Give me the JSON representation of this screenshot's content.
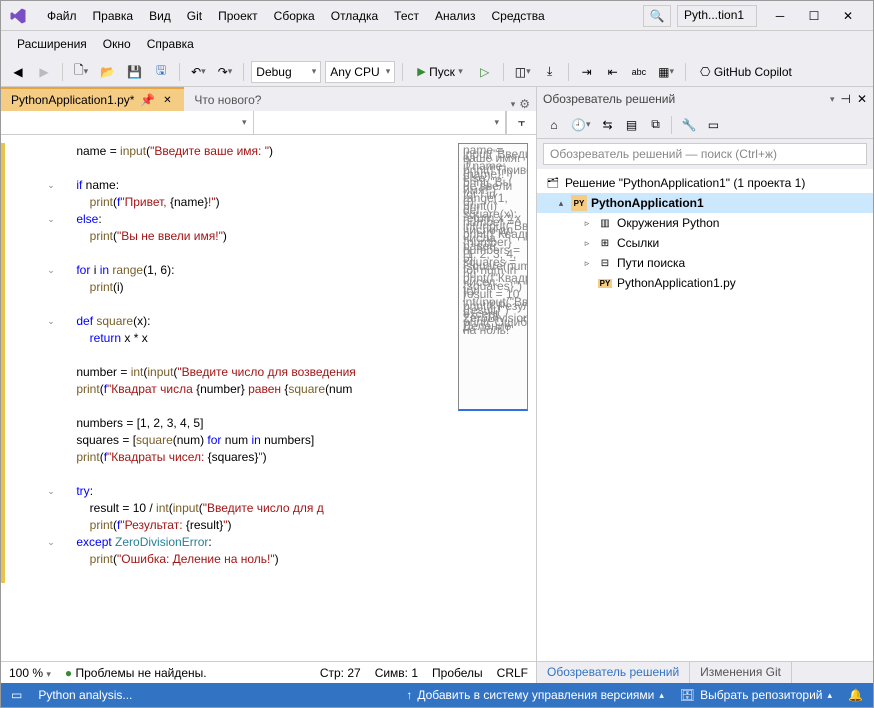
{
  "title_short": "Pyth...tion1",
  "menus": [
    "Файл",
    "Правка",
    "Вид",
    "Git",
    "Проект",
    "Сборка",
    "Отладка",
    "Тест",
    "Анализ",
    "Средства"
  ],
  "menus2": [
    "Расширения",
    "Окно",
    "Справка"
  ],
  "toolbar": {
    "config": "Debug",
    "platform": "Any CPU",
    "run": "Пуск",
    "copilot": "GitHub Copilot"
  },
  "tabs": {
    "active": "PythonApplication1.py*",
    "inactive": "Что нового?"
  },
  "code_lines": [
    {
      "indent": 1,
      "html": "name = <span class='fn'>input</span>(<span class='str'>\"Введите ваше имя: \"</span>)"
    },
    {
      "indent": 1,
      "html": ""
    },
    {
      "fold": true,
      "indent": 1,
      "html": "<span class='kw'>if</span> name:"
    },
    {
      "indent": 2,
      "html": "<span class='fn'>print</span>(<span class='kw'>f</span><span class='str'>\"Привет, </span>{name}<span class='str'>!\"</span>)"
    },
    {
      "fold": true,
      "indent": 1,
      "html": "<span class='kw'>else</span>:"
    },
    {
      "indent": 2,
      "html": "<span class='fn'>print</span>(<span class='str'>\"Вы не ввели имя!\"</span>)"
    },
    {
      "indent": 1,
      "html": ""
    },
    {
      "fold": true,
      "indent": 1,
      "html": "<span class='kw'>for</span> i <span class='kw'>in</span> <span class='fn'>range</span>(1, 6):"
    },
    {
      "indent": 2,
      "html": "<span class='fn'>print</span>(i)"
    },
    {
      "indent": 1,
      "html": ""
    },
    {
      "fold": true,
      "indent": 1,
      "html": "<span class='kw'>def</span> <span class='fn'>square</span>(x):"
    },
    {
      "indent": 2,
      "html": "<span class='kw'>return</span> x * x"
    },
    {
      "indent": 1,
      "html": ""
    },
    {
      "indent": 1,
      "html": "number = <span class='fn'>int</span>(<span class='fn'>input</span>(<span class='str'>\"Введите число для возведения</span>"
    },
    {
      "indent": 1,
      "html": "<span class='fn'>print</span>(<span class='kw'>f</span><span class='str'>\"Квадрат числа </span>{number}<span class='str'> равен </span>{<span class='fn'>square</span>(num"
    },
    {
      "indent": 1,
      "html": ""
    },
    {
      "indent": 1,
      "html": "numbers = [1, 2, 3, 4, 5]"
    },
    {
      "indent": 1,
      "html": "squares = [<span class='fn'>square</span>(num) <span class='kw'>for</span> num <span class='kw'>in</span> numbers]"
    },
    {
      "indent": 1,
      "html": "<span class='fn'>print</span>(<span class='kw'>f</span><span class='str'>\"Квадраты чисел: </span>{squares}<span class='str'>\"</span>)"
    },
    {
      "indent": 1,
      "html": ""
    },
    {
      "fold": true,
      "indent": 1,
      "html": "<span class='kw'>try</span>:"
    },
    {
      "indent": 2,
      "html": "result = 10 / <span class='fn'>int</span>(<span class='fn'>input</span>(<span class='str'>\"Введите число для д</span>"
    },
    {
      "indent": 2,
      "html": "<span class='fn'>print</span>(<span class='kw'>f</span><span class='str'>\"Результат: </span>{result}<span class='str'>\"</span>)"
    },
    {
      "fold": true,
      "indent": 1,
      "html": "<span class='kw'>except</span> <span class='cls'>ZeroDivisionError</span>:"
    },
    {
      "indent": 2,
      "html": "<span class='fn'>print</span>(<span class='str'>\"Ошибка: Деление на ноль!\"</span>)"
    },
    {
      "indent": 2,
      "html": ""
    }
  ],
  "editor_status": {
    "zoom": "100 %",
    "problems": "Проблемы не найдены.",
    "line": "Стр: 27",
    "col": "Симв: 1",
    "spaces": "Пробелы",
    "eol": "CRLF"
  },
  "solution": {
    "title": "Обозреватель решений",
    "search_placeholder": "Обозреватель решений — поиск (Ctrl+ж)",
    "root": "Решение \"PythonApplication1\"  (1 проекта 1)",
    "project": "PythonApplication1",
    "nodes": [
      "Окружения Python",
      "Ссылки",
      "Пути поиска",
      "PythonApplication1.py"
    ],
    "tab1": "Обозреватель решений",
    "tab2": "Изменения Git"
  },
  "statusbar": {
    "left": "Python analysis...",
    "vcs": "Добавить в систему управления версиями",
    "repo": "Выбрать репозиторий"
  }
}
